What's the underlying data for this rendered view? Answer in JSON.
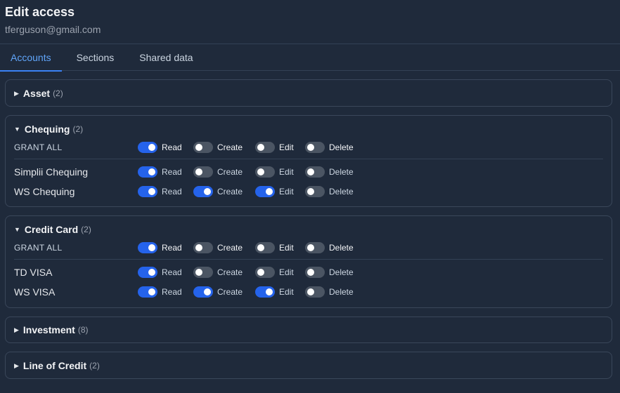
{
  "header": {
    "title": "Edit access",
    "email": "tferguson@gmail.com"
  },
  "tabs": [
    {
      "label": "Accounts",
      "active": true
    },
    {
      "label": "Sections",
      "active": false
    },
    {
      "label": "Shared data",
      "active": false
    }
  ],
  "permissions": [
    "Read",
    "Create",
    "Edit",
    "Delete"
  ],
  "grant_all_label": "GRANT ALL",
  "groups": [
    {
      "name": "Asset",
      "count": "(2)",
      "expanded": false
    },
    {
      "name": "Chequing",
      "count": "(2)",
      "expanded": true,
      "grant": [
        true,
        false,
        false,
        false
      ],
      "items": [
        {
          "name": "Simplii Chequing",
          "perms": [
            true,
            false,
            false,
            false
          ]
        },
        {
          "name": "WS Chequing",
          "perms": [
            true,
            true,
            true,
            false
          ]
        }
      ]
    },
    {
      "name": "Credit Card",
      "count": "(2)",
      "expanded": true,
      "grant": [
        true,
        false,
        false,
        false
      ],
      "items": [
        {
          "name": "TD VISA",
          "perms": [
            true,
            false,
            false,
            false
          ]
        },
        {
          "name": "WS VISA",
          "perms": [
            true,
            true,
            true,
            false
          ]
        }
      ]
    },
    {
      "name": "Investment",
      "count": "(8)",
      "expanded": false
    },
    {
      "name": "Line of Credit",
      "count": "(2)",
      "expanded": false
    }
  ],
  "colors": {
    "background": "#1f2a3b",
    "accent": "#3b82f6",
    "toggle_on": "#2563eb",
    "toggle_off": "#4b5563"
  }
}
